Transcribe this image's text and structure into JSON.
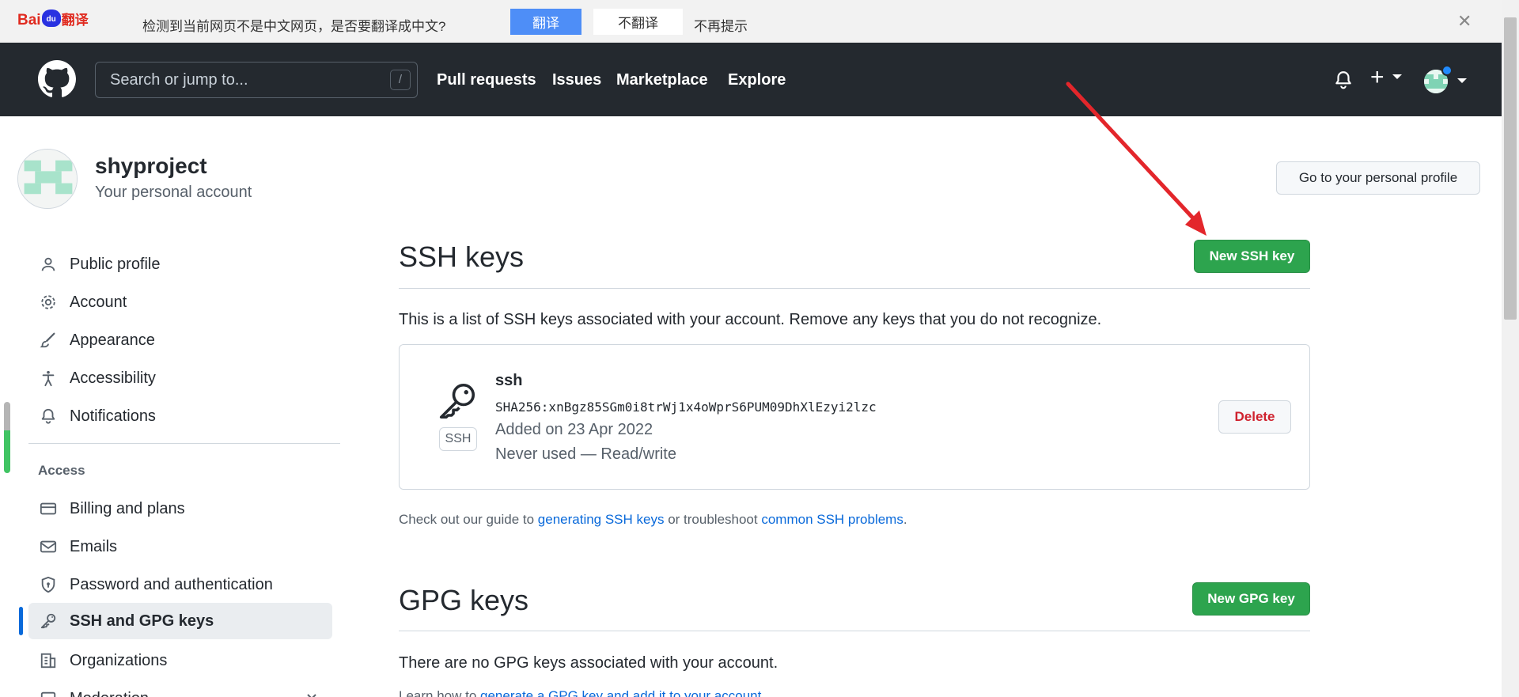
{
  "baidu_bar": {
    "logo_part1": "Bai",
    "logo_part2": "du",
    "logo_part3": "翻译",
    "message": "检测到当前网页不是中文网页，是否要翻译成中文?",
    "translate_label": "翻译",
    "no_translate_label": "不翻译",
    "no_more_label": "不再提示",
    "close_glyph": "✕"
  },
  "header": {
    "search_placeholder": "Search or jump to...",
    "search_shortcut": "/",
    "nav": [
      "Pull requests",
      "Issues",
      "Marketplace",
      "Explore"
    ],
    "plus_glyph": "+"
  },
  "profile": {
    "username": "shyproject",
    "subtitle": "Your personal account",
    "personal_profile_button": "Go to your personal profile"
  },
  "sidebar": {
    "items": [
      {
        "label": "Public profile",
        "icon": "person-icon"
      },
      {
        "label": "Account",
        "icon": "gear-icon"
      },
      {
        "label": "Appearance",
        "icon": "paintbrush-icon"
      },
      {
        "label": "Accessibility",
        "icon": "accessibility-icon"
      },
      {
        "label": "Notifications",
        "icon": "bell-icon"
      }
    ],
    "access_heading": "Access",
    "access_items": [
      {
        "label": "Billing and plans",
        "icon": "credit-card-icon"
      },
      {
        "label": "Emails",
        "icon": "mail-icon"
      },
      {
        "label": "Password and authentication",
        "icon": "shield-icon"
      },
      {
        "label": "SSH and GPG keys",
        "icon": "key-icon",
        "active": true
      },
      {
        "label": "Organizations",
        "icon": "organization-icon"
      },
      {
        "label": "Moderation",
        "icon": "moderation-icon"
      }
    ]
  },
  "ssh": {
    "title": "SSH keys",
    "new_button": "New SSH key",
    "intro": "This is a list of SSH keys associated with your account. Remove any keys that you do not recognize.",
    "keys": [
      {
        "title": "ssh",
        "badge": "SSH",
        "fingerprint": "SHA256:xnBgz85SGm0i8trWj1x4oWprS6PUM09DhXlEzyi2lzc",
        "added": "Added on 23 Apr 2022",
        "usage": "Never used — Read/write",
        "delete_label": "Delete"
      }
    ],
    "guide_prefix": "Check out our guide to ",
    "guide_link1": "generating SSH keys",
    "guide_middle": " or troubleshoot ",
    "guide_link2": "common SSH problems",
    "guide_suffix": "."
  },
  "gpg": {
    "title": "GPG keys",
    "new_button": "New GPG key",
    "empty_text": "There are no GPG keys associated with your account.",
    "learn_prefix": "Learn how to ",
    "learn_link": "generate a GPG key and add it to your account",
    "learn_suffix": "."
  },
  "colors": {
    "header_bg": "#24292f",
    "accent_green": "#2da44e",
    "link_blue": "#0969da",
    "danger_red": "#cf222e",
    "arrow_red": "#e3262b"
  }
}
